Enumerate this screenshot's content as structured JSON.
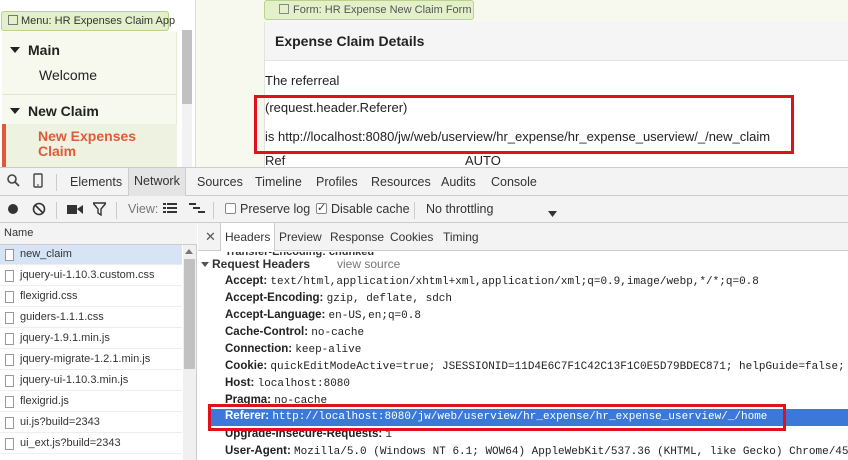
{
  "app": {
    "menu_tag": "Menu: HR Expenses Claim App",
    "form_tag": "Form: HR Expense New Claim Form",
    "menu": [
      {
        "label": "Main"
      },
      {
        "label": "Welcome"
      },
      {
        "label": "New Claim"
      },
      {
        "label": "New Expenses Claim"
      }
    ],
    "form": {
      "title": "Expense Claim Details",
      "line1": "The referreal",
      "line2": "(request.header.Referer)",
      "line3": "is http://localhost:8080/jw/web/userview/hr_expense/hr_expense_userview/_/new_claim",
      "ref_label": "Ref",
      "ref_value": "AUTO"
    }
  },
  "devtools": {
    "tabs": [
      "Elements",
      "Network",
      "Sources",
      "Timeline",
      "Profiles",
      "Resources",
      "Audits",
      "Console"
    ],
    "active_tab": "Network",
    "net_toolbar": {
      "view_label": "View:",
      "preserve_log": "Preserve log",
      "preserve_log_checked": false,
      "disable_cache": "Disable cache",
      "disable_cache_checked": true,
      "throttling": "No throttling"
    },
    "list": {
      "header": "Name",
      "files": [
        "new_claim",
        "jquery-ui-1.10.3.custom.css",
        "flexigrid.css",
        "guiders-1.1.1.css",
        "jquery-1.9.1.min.js",
        "jquery-migrate-1.2.1.min.js",
        "jquery-ui-1.10.3.min.js",
        "flexigrid.js",
        "ui.js?build=2343",
        "ui_ext.js?build=2343"
      ]
    },
    "detail_tabs": [
      "Headers",
      "Preview",
      "Response",
      "Cookies",
      "Timing"
    ],
    "active_detail_tab": "Headers",
    "cut_row": "Transfer-Encoding: chunked",
    "section_title": "Request Headers",
    "view_source": "view source",
    "headers": [
      {
        "k": "Accept:",
        "v": "text/html,application/xhtml+xml,application/xml;q=0.9,image/webp,*/*;q=0.8"
      },
      {
        "k": "Accept-Encoding:",
        "v": "gzip, deflate, sdch"
      },
      {
        "k": "Accept-Language:",
        "v": "en-US,en;q=0.8"
      },
      {
        "k": "Cache-Control:",
        "v": "no-cache"
      },
      {
        "k": "Connection:",
        "v": "keep-alive"
      },
      {
        "k": "Cookie:",
        "v": "quickEditModeActive=true; JSESSIONID=11D4E6C7F1C42C13F1C0E5D79BDEC871; helpGuide=false;"
      },
      {
        "k": "Host:",
        "v": "localhost:8080"
      },
      {
        "k": "Pragma:",
        "v": "no-cache"
      },
      {
        "k": "Referer:",
        "v": "http://localhost:8080/jw/web/userview/hr_expense/hr_expense_userview/_/home"
      },
      {
        "k": "Upgrade-Insecure-Requests:",
        "v": "1"
      },
      {
        "k": "User-Agent:",
        "v": "Mozilla/5.0 (Windows NT 6.1; WOW64) AppleWebKit/537.36 (KHTML, like Gecko) Chrome/45"
      }
    ],
    "selected_header_index": 8
  },
  "colors": {
    "highlight_box": "#e0101e",
    "selected_row": "#3b78d8",
    "menu_active": "#e05a3a",
    "tag_bg": "#e3f0c9"
  }
}
